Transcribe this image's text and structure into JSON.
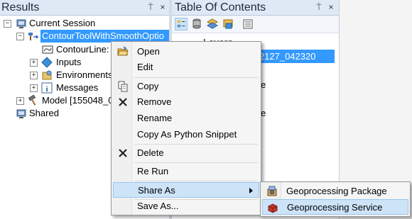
{
  "results": {
    "title": "Results",
    "pin_glyph": "⍑",
    "close_glyph": "×",
    "tree": {
      "current_session": "Current Session",
      "tool_item": "ContourToolWithSmoothOptio",
      "contour_line": "ContourLine:",
      "inputs": "Inputs",
      "environments": "Environments",
      "messages": "Messages",
      "model": "Model [155048_0",
      "shared": "Shared"
    }
  },
  "toc": {
    "title": "Table Of Contents",
    "pin_glyph": "⍑",
    "close_glyph": "×",
    "layers_label": "Layers",
    "selected_text": "e [182127_042320",
    "row_fragment_1": "e",
    "row_fragment_2": "e"
  },
  "context_menu": {
    "items": [
      {
        "label": "Open",
        "icon": "open-folder-icon"
      },
      {
        "label": "Edit"
      },
      {
        "label": "Copy",
        "icon": "copy-icon"
      },
      {
        "label": "Remove",
        "icon": "remove-x-icon"
      },
      {
        "label": "Rename"
      },
      {
        "label": "Copy As Python Snippet"
      },
      {
        "label": "Delete",
        "icon": "delete-x-icon"
      },
      {
        "label": "Re Run"
      },
      {
        "label": "Share As",
        "has_submenu": true,
        "highlighted": true
      },
      {
        "label": "Save As..."
      }
    ]
  },
  "submenu": {
    "items": [
      {
        "label": "Geoprocessing Package",
        "icon": "package-icon"
      },
      {
        "label": "Geoprocessing Service",
        "icon": "service-icon",
        "highlighted": true
      }
    ]
  },
  "colors": {
    "selection": "#3399ff",
    "menu_highlight": "#cde3f8",
    "header_bg": "#dfe9f5"
  }
}
